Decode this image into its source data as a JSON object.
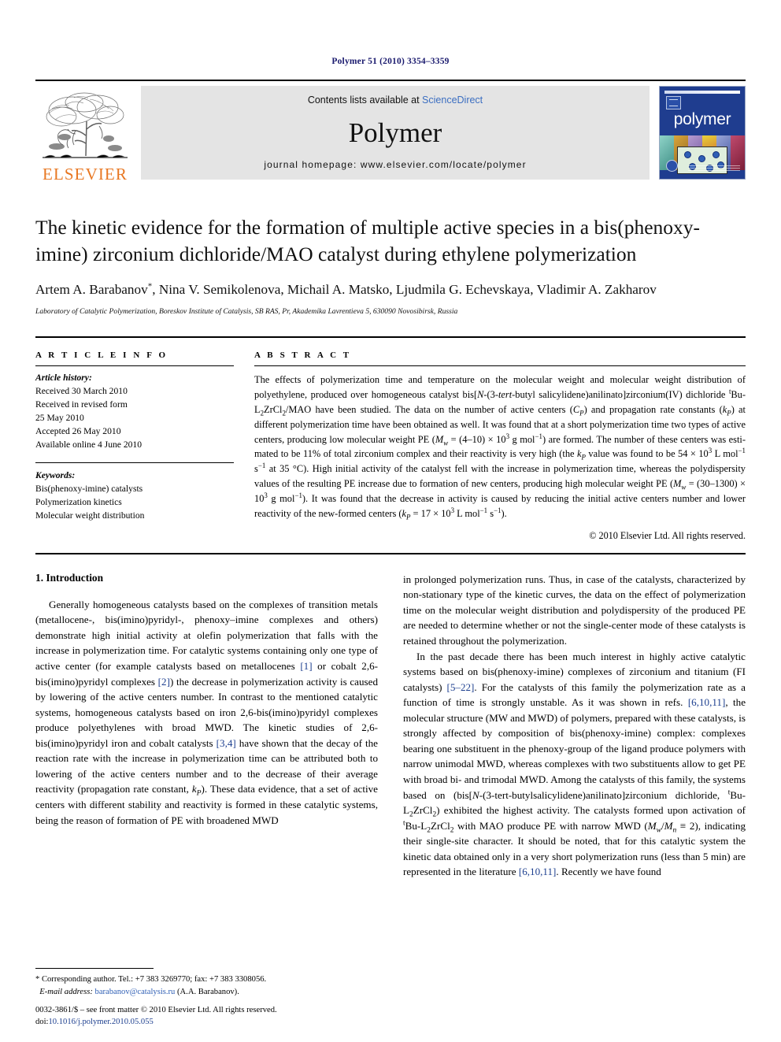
{
  "running_head": "Polymer 51 (2010) 3354–3359",
  "masthead": {
    "publisher_name": "ELSEVIER",
    "contents_prefix": "Contents lists available at ",
    "sciencedirect": "ScienceDirect",
    "journal_name": "Polymer",
    "homepage": "journal homepage: www.elsevier.com/locate/polymer",
    "cover_title": "polymer"
  },
  "article": {
    "title": "The kinetic evidence for the formation of multiple active species in a bis(phenoxy-imine) zirconium dichloride/MAO catalyst during ethylene polymerization",
    "authors": "Artem A. Barabanov*, Nina V. Semikolenova, Michail A. Matsko, Ljudmila G. Echevskaya, Vladimir A. Zakharov",
    "affiliation": "Laboratory of Catalytic Polymerization, Boreskov Institute of Catalysis, SB RAS, Pr, Akademika Lavrentieva 5, 630090 Novosibirsk, Russia"
  },
  "info": {
    "heading": "A R T I C L E   I N F O",
    "history_label": "Article history:",
    "history": [
      "Received 30 March 2010",
      "Received in revised form",
      "25 May 2010",
      "Accepted 26 May 2010",
      "Available online 4 June 2010"
    ],
    "keywords_label": "Keywords:",
    "keywords": [
      "Bis(phenoxy-imine) catalysts",
      "Polymerization kinetics",
      "Molecular weight distribution"
    ]
  },
  "abstract": {
    "heading": "A B S T R A C T",
    "copyright": "© 2010 Elsevier Ltd. All rights reserved."
  },
  "sections": {
    "intro_heading": "1. Introduction"
  },
  "footnote": {
    "corresponding": "* Corresponding author. Tel.: +7 383 3269770; fax: +7 383 3308056.",
    "email_label": "E-mail address:",
    "email": "barabanov@catalysis.ru",
    "email_suffix": " (A.A. Barabanov)."
  },
  "page_footer": {
    "issn_line": "0032-3861/$ – see front matter © 2010 Elsevier Ltd. All rights reserved.",
    "doi_prefix": "doi:",
    "doi": "10.1016/j.polymer.2010.05.055"
  },
  "colors": {
    "elsevier_orange": "#E87722",
    "link_blue": "#2f5fb5",
    "ref_blue": "#1d3f8f",
    "cover_blue": "#1f3d8f",
    "running_head": "#1a1a6e"
  }
}
